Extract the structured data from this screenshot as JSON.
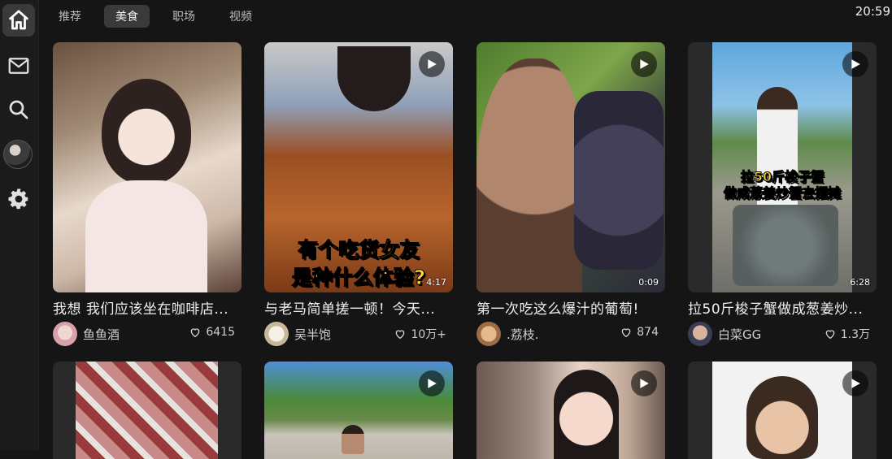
{
  "tabs": [
    "推荐",
    "美食",
    "职场",
    "视频"
  ],
  "active_tab": 1,
  "clock": "20:59",
  "sidebar": {
    "items": [
      {
        "name": "home-icon",
        "active": true
      },
      {
        "name": "mail-icon"
      },
      {
        "name": "search-icon"
      },
      {
        "name": "user-avatar"
      },
      {
        "name": "gear-icon"
      }
    ]
  },
  "cards": [
    {
      "title": "我想 我们应该坐在咖啡店...",
      "user": "鱼鱼酒",
      "likes": "6415",
      "duration": "",
      "video": false
    },
    {
      "title": "与老马简单搓一顿！今天...",
      "user": "吴半饱",
      "likes": "10万+",
      "duration": "4:17",
      "video": true,
      "caption": [
        "有个吃货女友",
        "是种什么体验?"
      ]
    },
    {
      "title": "第一次吃这么爆汁的葡萄!",
      "user": ".荔枝.",
      "likes": "874",
      "duration": "0:09",
      "video": true
    },
    {
      "title": "拉50斤梭子蟹做成葱姜炒...",
      "user": "白菜GG",
      "likes": "1.3万",
      "duration": "6:28",
      "video": true,
      "caption": [
        "拉50斤梭子蟹",
        "做成葱姜炒蟹去摆摊"
      ]
    }
  ],
  "row2_cards": [
    {
      "video": false
    },
    {
      "video": true
    },
    {
      "video": true
    },
    {
      "video": true
    }
  ],
  "colors": {
    "background": "#151515",
    "tab_active_bg": "#3a3a3a",
    "caption_yellow": "#ffd83a"
  }
}
